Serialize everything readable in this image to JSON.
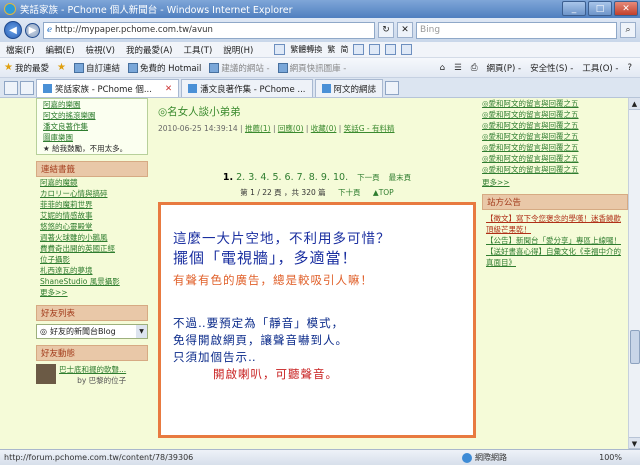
{
  "window": {
    "title": "笑話家族 - PChome 個人新聞台 - Windows Internet Explorer"
  },
  "address": {
    "url": "http://mypaper.pchome.com.tw/avun",
    "search_placeholder": "Bing"
  },
  "menu": [
    "檔案(F)",
    "編輯(E)",
    "檢視(V)",
    "我的最愛(A)",
    "工具(T)",
    "說明(H)"
  ],
  "menu_tools": {
    "convert": "繁體轉換",
    "trad": "繁",
    "simp": "简"
  },
  "favorites": {
    "label": "我的最愛",
    "items": [
      "自訂連結",
      "免費的 Hotmail",
      "建議的網站 -",
      "網頁快訊圖庫 -"
    ],
    "right_tools": [
      "網頁(P) -",
      "安全性(S) -",
      "工具(O) -"
    ]
  },
  "tabs": [
    {
      "label": "笑話家族 - PChome 個..."
    },
    {
      "label": "潘文良著作集 - PChome ..."
    },
    {
      "label": "阿文的網誌"
    }
  ],
  "left": {
    "top_links": [
      "阿嘉的樂園",
      "阿文的搖滾樂園",
      "潘文良著作集",
      "圖庫樂園"
    ],
    "star_link": "給我鼓勵，不用太多。",
    "links_header": "連結書籤",
    "links": [
      "阿嘉的魔鏡",
      "カロリー心情與搞碎",
      "菲菲的魔莉世界",
      "艾妮的情感故事",
      "悠悠的心靈殿堂",
      "週著火球雖的小鵝風",
      "費費奇出開的英國正經",
      "位子攝影",
      "札西達瓦的夢境",
      "ShaneStudio 風景攝影"
    ],
    "more": "更多>>",
    "friends_header": "好友列表",
    "blog_select": "好友的新聞台Blog",
    "news_header": "好友動態",
    "friend_text": "巴士底和擺的軟聲...",
    "friend_by": "by 巴黎的位子"
  },
  "post": {
    "title": "◎名女人談小弟弟",
    "date": "2010-06-25 14:39:14",
    "meta_links": [
      "推薦(1)",
      "回應(0)",
      "收藏(0)",
      "笑話G - 有料精"
    ],
    "pages": [
      "1.",
      "2.",
      "3.",
      "4.",
      "5.",
      "6.",
      "7.",
      "8.",
      "9.",
      "10."
    ],
    "next_page": "下一頁",
    "last_page": "最末頁",
    "page_info": "第 1 / 22 頁 ，共 320 篇",
    "next_ten": "下十頁",
    "top": "▲TOP"
  },
  "ad": {
    "line1": "這麼一大片空地，不利用多可惜？",
    "line2": "擺個「電視牆」，多適當！",
    "line3": "有聲有色的廣告，總是較吸引人嘛！",
    "line4": "不過‥要預定為「靜音」模式，",
    "line5": "免得開啟網頁，讓聲音嚇到人。",
    "line6": "只須加個告示‥",
    "line7": "開啟喇叭，可聽聲音。"
  },
  "right": {
    "items": [
      "◎愛和阿文的留言與回覆之五",
      "◎愛和阿文的留言與回覆之五",
      "◎愛和阿文的留言與回覆之五",
      "◎愛和阿文的留言與回覆之五",
      "◎愛和阿文的留言與回覆之五",
      "◎愛和阿文的留言與回覆之五",
      "◎愛和阿文的留言與回覆之五"
    ],
    "more": "更多>>",
    "header": "站方公告",
    "notices": [
      "【徵文】寫下令您褒念的學嘆！迷香饒歡頂級芒果乾！",
      "【公告】新聞台「愛分享」專區上線囉！",
      "【送好書喜心得】自彙文化《幸福中介的真面目》"
    ]
  },
  "status": {
    "url": "http://forum.pchome.com.tw/content/78/39306",
    "zone": "網際網路",
    "zoom": "100%"
  }
}
